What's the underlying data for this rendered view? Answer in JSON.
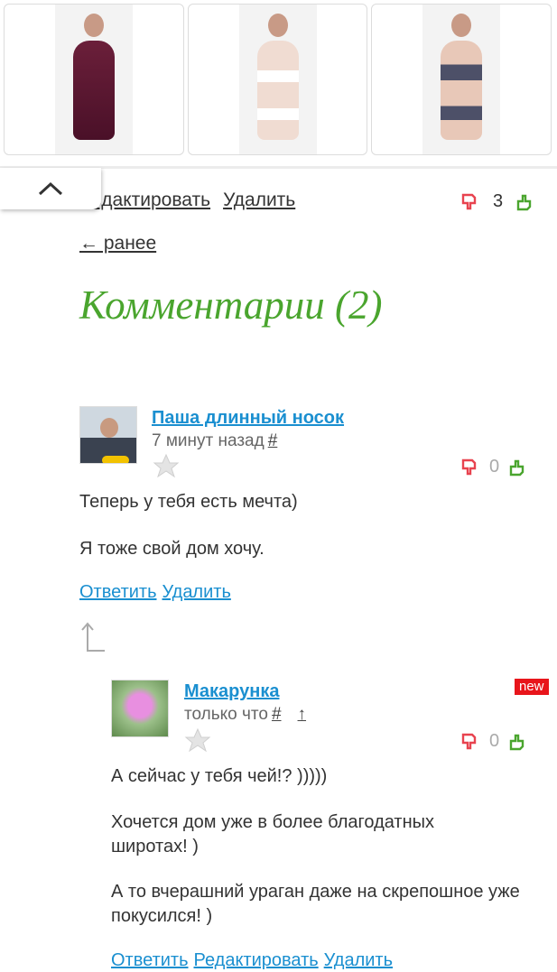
{
  "products": [
    {
      "name": "product-robe"
    },
    {
      "name": "product-white-lingerie"
    },
    {
      "name": "product-lace-lingerie"
    }
  ],
  "post_actions": {
    "edit": "Редактировать",
    "delete": "Удалить",
    "vote_count": "3"
  },
  "nav": {
    "back": "← ранее"
  },
  "comments_title": "Комментарии (2)",
  "comments": [
    {
      "author": "Паша длинный носок",
      "time": "7 минут назад",
      "hash": "#",
      "votes": "0",
      "paragraphs": [
        "Теперь у тебя есть мечта)",
        "Я тоже свой дом хочу."
      ],
      "actions": {
        "reply": "Ответить",
        "delete": "Удалить"
      }
    },
    {
      "author": "Макарунка",
      "time": "только что",
      "hash": "#",
      "parent_link": "↑",
      "badge": "new",
      "votes": "0",
      "paragraphs": [
        "А сейчас у тебя чей!? )))))",
        "Хочется дом уже в более благодатных широтах! )",
        "А то вчерашний ураган даже на скрепошное уже покусился! )"
      ],
      "actions": {
        "reply": "Ответить",
        "edit": "Редактировать",
        "delete": "Удалить"
      }
    }
  ],
  "colors": {
    "link": "#1a8fd0",
    "title": "#4aa52e",
    "dislike": "#e8434f",
    "like": "#4aa52e",
    "badge": "#e8151b"
  },
  "icons": {
    "collapse": "chevron-up-icon",
    "dislike": "thumbs-down-icon",
    "like": "thumbs-up-icon",
    "favorite": "star-icon",
    "reply_thread": "reply-arrow-icon"
  }
}
